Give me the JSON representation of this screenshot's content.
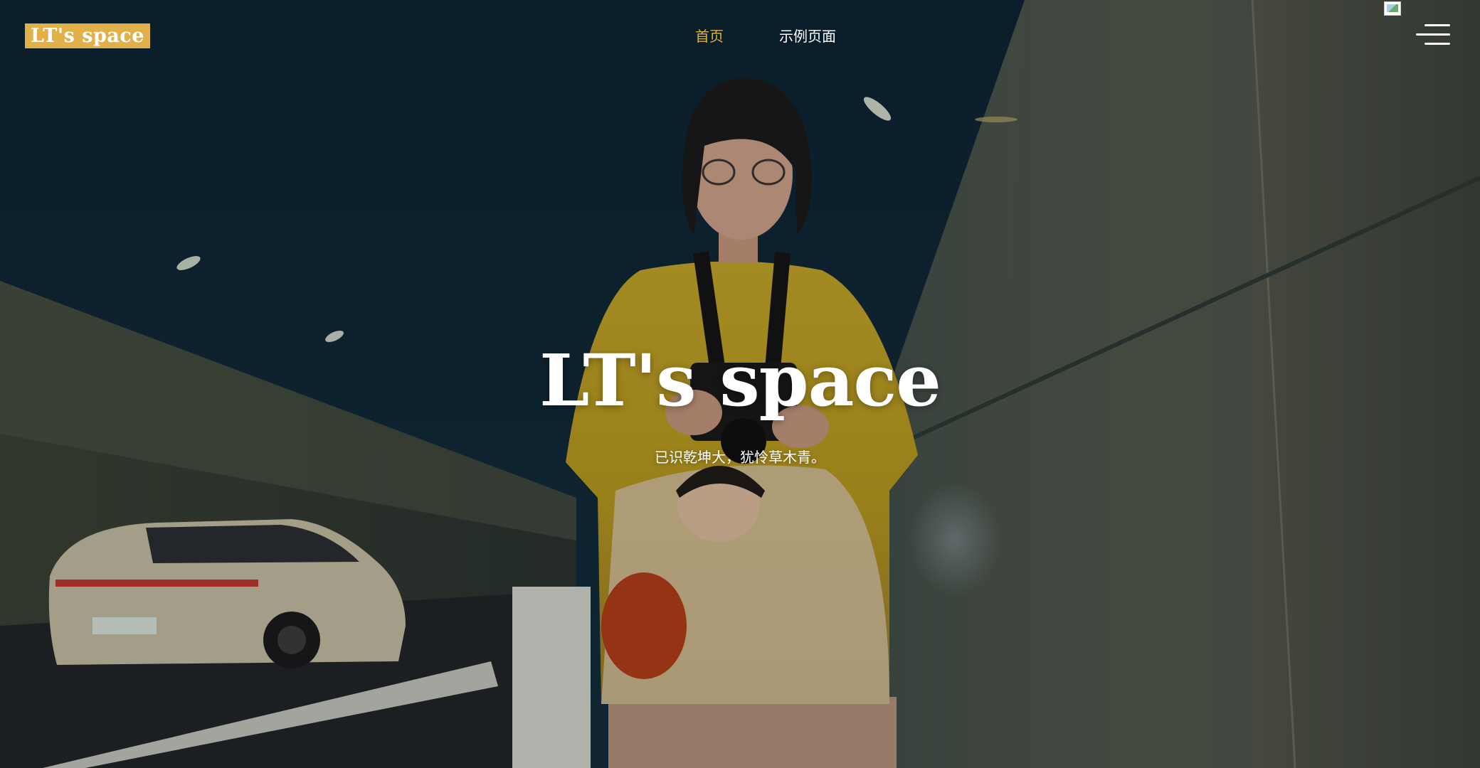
{
  "header": {
    "logo_text": "LT's space",
    "nav": [
      {
        "label": "首页",
        "active": true
      },
      {
        "label": "示例页面",
        "active": false
      }
    ],
    "menu_icon": "hamburger-menu-icon",
    "broken_image_icon": "broken-image-icon"
  },
  "hero": {
    "title": "LT's space",
    "subtitle": "已识乾坤大，犹怜草木青。"
  },
  "colors": {
    "accent": "#e1b049",
    "text": "#ffffff",
    "background": "#0f2433"
  }
}
